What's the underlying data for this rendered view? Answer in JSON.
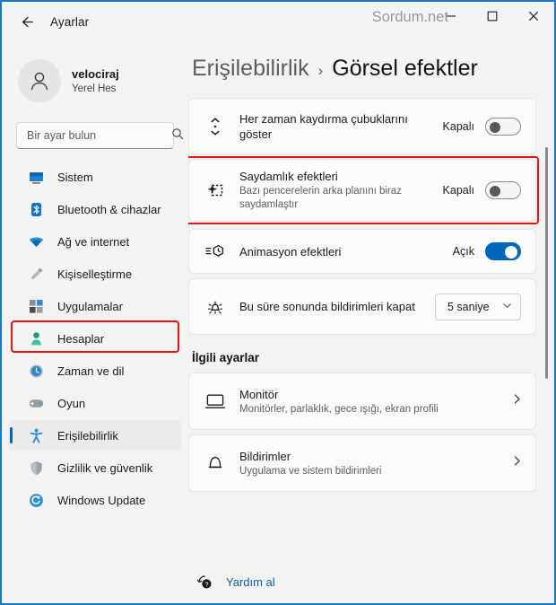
{
  "window": {
    "app_title": "Ayarlar",
    "watermark": "Sordum.net",
    "back_icon": "back-arrow-icon",
    "minimize_label": "–",
    "maximize_label": "□",
    "close_label": "✕",
    "accent_color": "#0067c0",
    "highlight_color": "#ee1111"
  },
  "sidebar": {
    "profile": {
      "name": "velociraj",
      "account_type": "Yerel Hes"
    },
    "search": {
      "placeholder": "Bir ayar bulun",
      "icon": "search-icon"
    },
    "items": [
      {
        "label": "Sistem",
        "icon": "system-icon",
        "selected": false
      },
      {
        "label": "Bluetooth & cihazlar",
        "icon": "bluetooth-icon",
        "selected": false
      },
      {
        "label": "Ağ ve internet",
        "icon": "network-icon",
        "selected": false
      },
      {
        "label": "Kişiselleştirme",
        "icon": "brush-icon",
        "selected": false
      },
      {
        "label": "Uygulamalar",
        "icon": "apps-icon",
        "selected": false
      },
      {
        "label": "Hesaplar",
        "icon": "accounts-icon",
        "selected": false
      },
      {
        "label": "Zaman ve dil",
        "icon": "clock-icon",
        "selected": false
      },
      {
        "label": "Oyun",
        "icon": "gamepad-icon",
        "selected": false
      },
      {
        "label": "Erişilebilirlik",
        "icon": "accessibility-icon",
        "selected": true
      },
      {
        "label": "Gizlilik ve güvenlik",
        "icon": "shield-icon",
        "selected": false
      },
      {
        "label": "Windows Update",
        "icon": "update-icon",
        "selected": false
      }
    ]
  },
  "main": {
    "breadcrumb": {
      "parent": "Erişilebilirlik",
      "separator": "›",
      "current": "Görsel efektler"
    },
    "settings": [
      {
        "title": "Her zaman kaydırma çubuklarını göster",
        "subtitle": "",
        "icon": "scrollbar-icon",
        "control": "toggle",
        "state_label": "Kapalı",
        "state": "off",
        "highlighted": false
      },
      {
        "title": "Saydamlık efektleri",
        "subtitle": "Bazı pencerelerin arka planını biraz saydamlaştır",
        "icon": "transparency-sparkle-icon",
        "control": "toggle",
        "state_label": "Kapalı",
        "state": "off",
        "highlighted": true
      },
      {
        "title": "Animasyon efektleri",
        "subtitle": "",
        "icon": "animation-icon",
        "control": "toggle",
        "state_label": "Açık",
        "state": "on",
        "highlighted": false
      },
      {
        "title": "Bu süre sonunda bildirimleri kapat",
        "subtitle": "",
        "icon": "notification-timeout-icon",
        "control": "dropdown",
        "state_label": "5 saniye",
        "state": "",
        "highlighted": false
      }
    ],
    "related_heading": "İlgili ayarlar",
    "related": [
      {
        "title": "Monitör",
        "subtitle": "Monitörler, parlaklık, gece ışığı, ekran profili",
        "icon": "monitor-icon",
        "chevron": "chevron-right-icon"
      },
      {
        "title": "Bildirimler",
        "subtitle": "Uygulama ve sistem bildirimleri",
        "icon": "bell-icon",
        "chevron": "chevron-right-icon"
      }
    ]
  },
  "footer": {
    "help_label": "Yardım al",
    "help_icon": "help-question-icon"
  }
}
